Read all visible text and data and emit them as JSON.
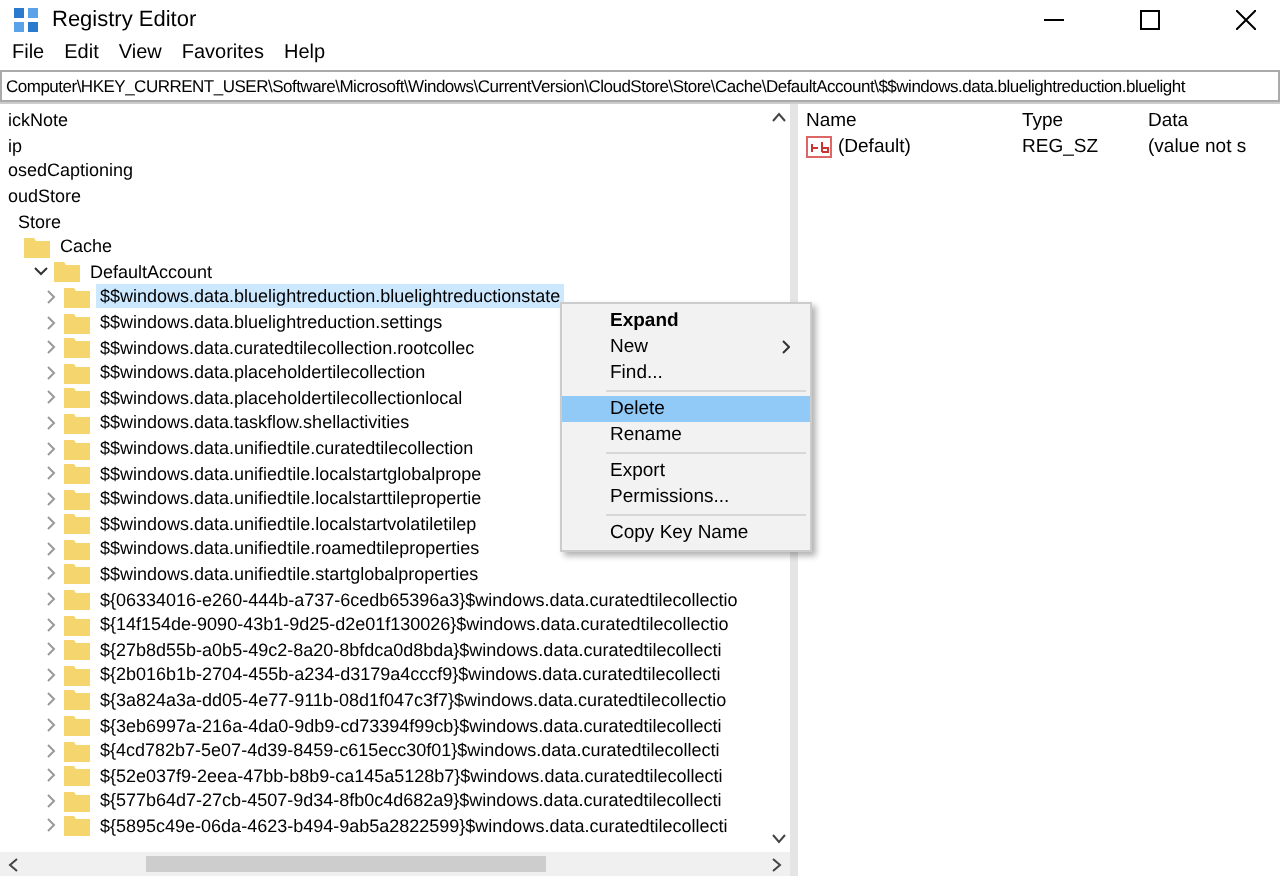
{
  "window": {
    "title": "Registry Editor"
  },
  "menu_bar": [
    "File",
    "Edit",
    "View",
    "Favorites",
    "Help"
  ],
  "address": "Computer\\HKEY_CURRENT_USER\\Software\\Microsoft\\Windows\\CurrentVersion\\CloudStore\\Store\\Cache\\DefaultAccount\\$$windows.data.bluelightreduction.bluelight",
  "tree": [
    {
      "label": "ickNote",
      "selected": false
    },
    {
      "label": "ip",
      "selected": false
    },
    {
      "label": "osedCaptioning",
      "selected": false
    },
    {
      "label": "oudStore",
      "selected": false,
      "children": [
        {
          "label": "Store",
          "selected": false,
          "children": [
            {
              "label": "Cache",
              "selected": false,
              "children": [
                {
                  "label": "DefaultAccount",
                  "selected": false,
                  "expanded": true,
                  "children": [
                    {
                      "label": "$$windows.data.bluelightreduction.bluelightreductionstate",
                      "selected": true,
                      "expanded": false
                    },
                    {
                      "label": "$$windows.data.bluelightreduction.settings",
                      "selected": false,
                      "expanded": false
                    },
                    {
                      "label": "$$windows.data.curatedtilecollection.rootcollec",
                      "selected": false,
                      "expanded": false
                    },
                    {
                      "label": "$$windows.data.placeholdertilecollection",
                      "selected": false,
                      "expanded": false
                    },
                    {
                      "label": "$$windows.data.placeholdertilecollectionlocal",
                      "selected": false,
                      "expanded": false
                    },
                    {
                      "label": "$$windows.data.taskflow.shellactivities",
                      "selected": false,
                      "expanded": false
                    },
                    {
                      "label": "$$windows.data.unifiedtile.curatedtilecollection",
                      "selected": false,
                      "expanded": false
                    },
                    {
                      "label": "$$windows.data.unifiedtile.localstartglobalprope",
                      "selected": false,
                      "expanded": false
                    },
                    {
                      "label": "$$windows.data.unifiedtile.localstarttilepropertie",
                      "selected": false,
                      "expanded": false
                    },
                    {
                      "label": "$$windows.data.unifiedtile.localstartvolatiletilep",
                      "selected": false,
                      "expanded": false
                    },
                    {
                      "label": "$$windows.data.unifiedtile.roamedtileproperties",
                      "selected": false,
                      "expanded": false
                    },
                    {
                      "label": "$$windows.data.unifiedtile.startglobalproperties",
                      "selected": false,
                      "expanded": false
                    },
                    {
                      "label": "${06334016-e260-444b-a737-6cedb65396a3}$windows.data.curatedtilecollectio",
                      "selected": false,
                      "expanded": false
                    },
                    {
                      "label": "${14f154de-9090-43b1-9d25-d2e01f130026}$windows.data.curatedtilecollectio",
                      "selected": false,
                      "expanded": false
                    },
                    {
                      "label": "${27b8d55b-a0b5-49c2-8a20-8bfdca0d8bda}$windows.data.curatedtilecollecti",
                      "selected": false,
                      "expanded": false
                    },
                    {
                      "label": "${2b016b1b-2704-455b-a234-d3179a4cccf9}$windows.data.curatedtilecollecti",
                      "selected": false,
                      "expanded": false
                    },
                    {
                      "label": "${3a824a3a-dd05-4e77-911b-08d1f047c3f7}$windows.data.curatedtilecollectio",
                      "selected": false,
                      "expanded": false
                    },
                    {
                      "label": "${3eb6997a-216a-4da0-9db9-cd73394f99cb}$windows.data.curatedtilecollecti",
                      "selected": false,
                      "expanded": false
                    },
                    {
                      "label": "${4cd782b7-5e07-4d39-8459-c615ecc30f01}$windows.data.curatedtilecollecti",
                      "selected": false,
                      "expanded": false
                    },
                    {
                      "label": "${52e037f9-2eea-47bb-b8b9-ca145a5128b7}$windows.data.curatedtilecollecti",
                      "selected": false,
                      "expanded": false
                    },
                    {
                      "label": "${577b64d7-27cb-4507-9d34-8fb0c4d682a9}$windows.data.curatedtilecollecti",
                      "selected": false,
                      "expanded": false
                    },
                    {
                      "label": "${5895c49e-06da-4623-b494-9ab5a2822599}$windows.data.curatedtilecollecti",
                      "selected": false,
                      "expanded": false
                    }
                  ]
                }
              ]
            }
          ]
        }
      ]
    }
  ],
  "context_menu": [
    {
      "kind": "item",
      "label": "Expand",
      "default": true,
      "submenu": false,
      "selected": false
    },
    {
      "kind": "item",
      "label": "New",
      "default": false,
      "submenu": true,
      "selected": false
    },
    {
      "kind": "item",
      "label": "Find...",
      "default": false,
      "submenu": false,
      "selected": false
    },
    {
      "kind": "separator"
    },
    {
      "kind": "item",
      "label": "Delete",
      "default": false,
      "submenu": false,
      "selected": true
    },
    {
      "kind": "item",
      "label": "Rename",
      "default": false,
      "submenu": false,
      "selected": false
    },
    {
      "kind": "separator"
    },
    {
      "kind": "item",
      "label": "Export",
      "default": false,
      "submenu": false,
      "selected": false
    },
    {
      "kind": "item",
      "label": "Permissions...",
      "default": false,
      "submenu": false,
      "selected": false
    },
    {
      "kind": "separator"
    },
    {
      "kind": "item",
      "label": "Copy Key Name",
      "default": false,
      "submenu": false,
      "selected": false
    }
  ],
  "values": {
    "columns": [
      "Name",
      "Type",
      "Data"
    ],
    "rows": [
      {
        "name": "(Default)",
        "type": "REG_SZ",
        "data": "(value not s"
      }
    ]
  }
}
